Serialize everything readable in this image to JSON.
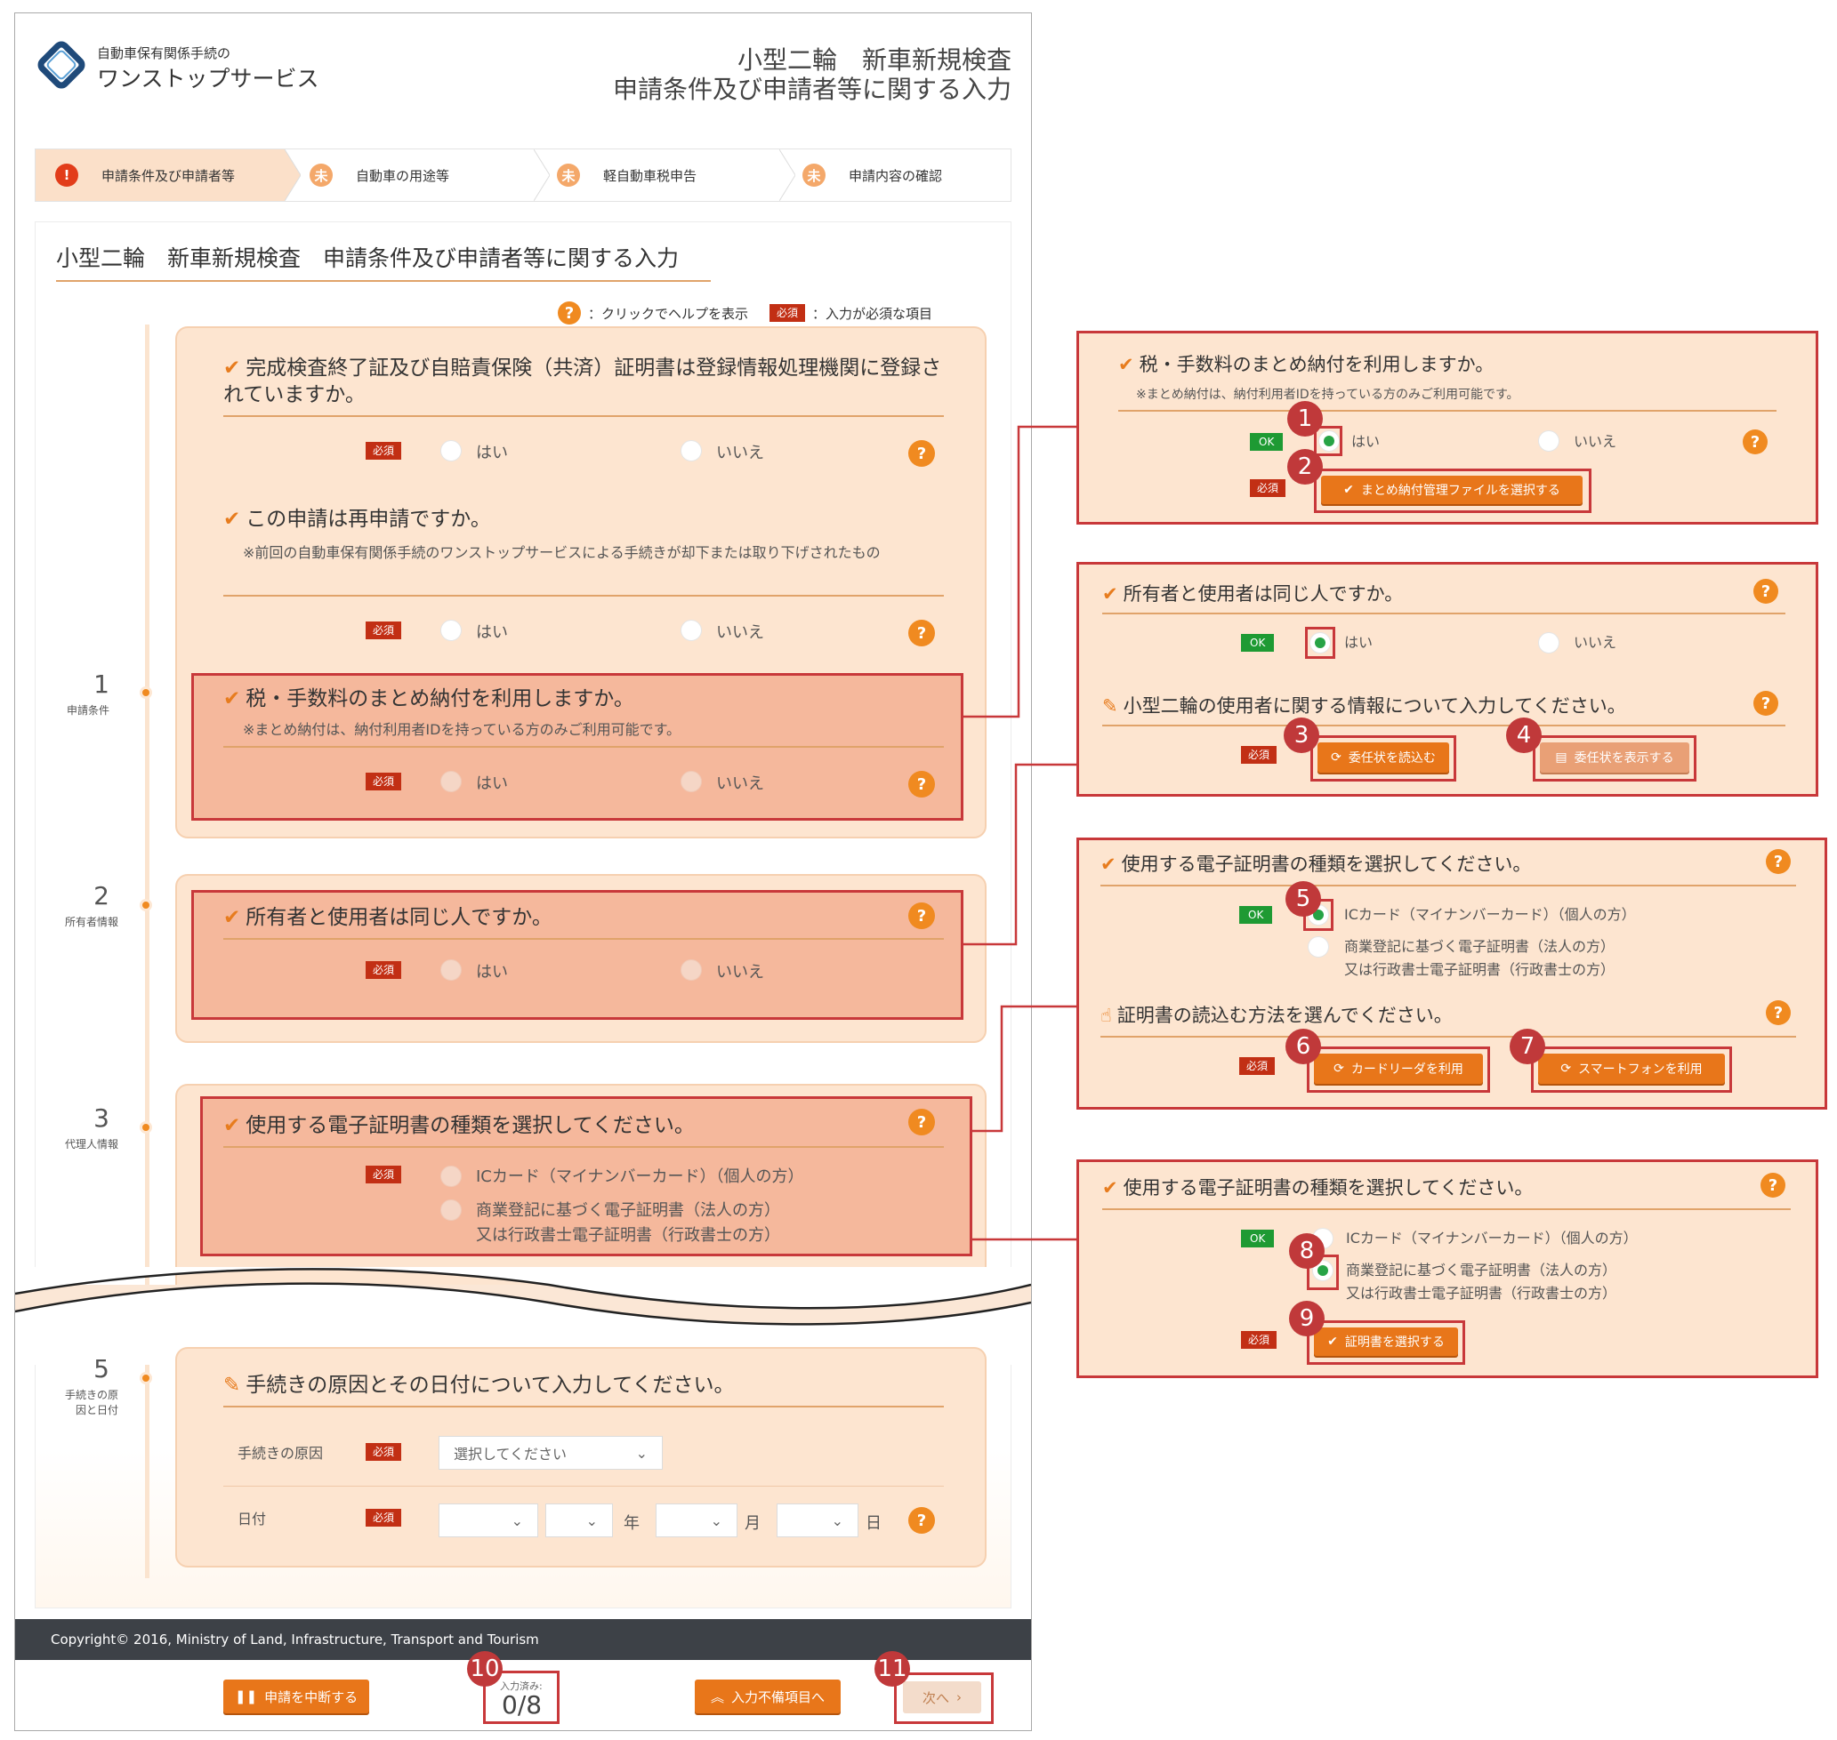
{
  "header": {
    "logo_small": "自動車保有関係手続の",
    "logo_big": "ワンストップサービス",
    "title_line1": "小型二輪　新車新規検査",
    "title_line2": "申請条件及び申請者等に関する入力"
  },
  "steps": [
    {
      "icon": "!",
      "label": "申請条件及び申請者等"
    },
    {
      "icon": "未",
      "label": "自動車の用途等"
    },
    {
      "icon": "未",
      "label": "軽自動車税申告"
    },
    {
      "icon": "未",
      "label": "申請内容の確認"
    }
  ],
  "page_title": "小型二輪　新車新規検査　申請条件及び申請者等に関する入力",
  "legend": {
    "help_text": "：クリックでヘルプを表示",
    "required_text": "：入力が必須な項目"
  },
  "labels": {
    "required": "必須",
    "ok": "OK",
    "yes": "はい",
    "no": "いいえ",
    "help": "?",
    "year": "年",
    "month": "月",
    "day": "日"
  },
  "sections": [
    {
      "num": "1",
      "label": "申請条件"
    },
    {
      "num": "2",
      "label": "所有者情報"
    },
    {
      "num": "3",
      "label": "代理人情報"
    },
    {
      "num": "5",
      "label": "手続きの原因と日付"
    }
  ],
  "questions": {
    "q1": "完成検査終了証及び自賠責保険（共済）証明書は登録情報処理機関に登録されていますか。",
    "q2": "この申請は再申請ですか。",
    "q2_note": "※前回の自動車保有関係手続のワンストップサービスによる手続きが却下または取り下げされたもの",
    "q3": "税・手数料のまとめ納付を利用しますか。",
    "q3_note": "※まとめ納付は、納付利用者IDを持っている方のみご利用可能です。",
    "q4": "所有者と使用者は同じ人ですか。",
    "q5": "使用する電子証明書の種類を選択してください。",
    "q5_opt1": "ICカード（マイナンバーカード）（個人の方）",
    "q5_opt2a": "商業登記に基づく電子証明書（法人の方）",
    "q5_opt2b": "又は行政書士電子証明書（行政書士の方）",
    "q6": "手続きの原因とその日付について入力してください。",
    "q6_cause": "手続きの原因",
    "q6_date": "日付",
    "q6_select": "選択してください"
  },
  "footer": {
    "copyright": "Copyright© 2016, Ministry of Land, Infrastructure, Transport and Tourism",
    "suspend": "申請を中断する",
    "progress_label": "入力済み:",
    "progress_value": "0/8",
    "incomplete": "入力不備項目へ",
    "next": "次へ"
  },
  "callouts": {
    "c1_select_file": "まとめ納付管理ファイルを選択する",
    "c2_q": "小型二輪の使用者に関する情報について入力してください。",
    "c2_read": "委任状を読込む",
    "c2_show": "委任状を表示する",
    "c3_q": "証明書の読込む方法を選んでください。",
    "c3_card": "カードリーダを利用",
    "c3_phone": "スマートフォンを利用",
    "c4_select_cert": "証明書を選択する"
  },
  "markers": [
    "1",
    "2",
    "3",
    "4",
    "5",
    "6",
    "7",
    "8",
    "9",
    "10",
    "11"
  ],
  "colors": {
    "accent": "#f08a20",
    "required": "#c22f14",
    "ok": "#1e9a33",
    "highlight": "#c8383a",
    "panel": "#fde5d0",
    "footer_bar": "#3d4147"
  }
}
